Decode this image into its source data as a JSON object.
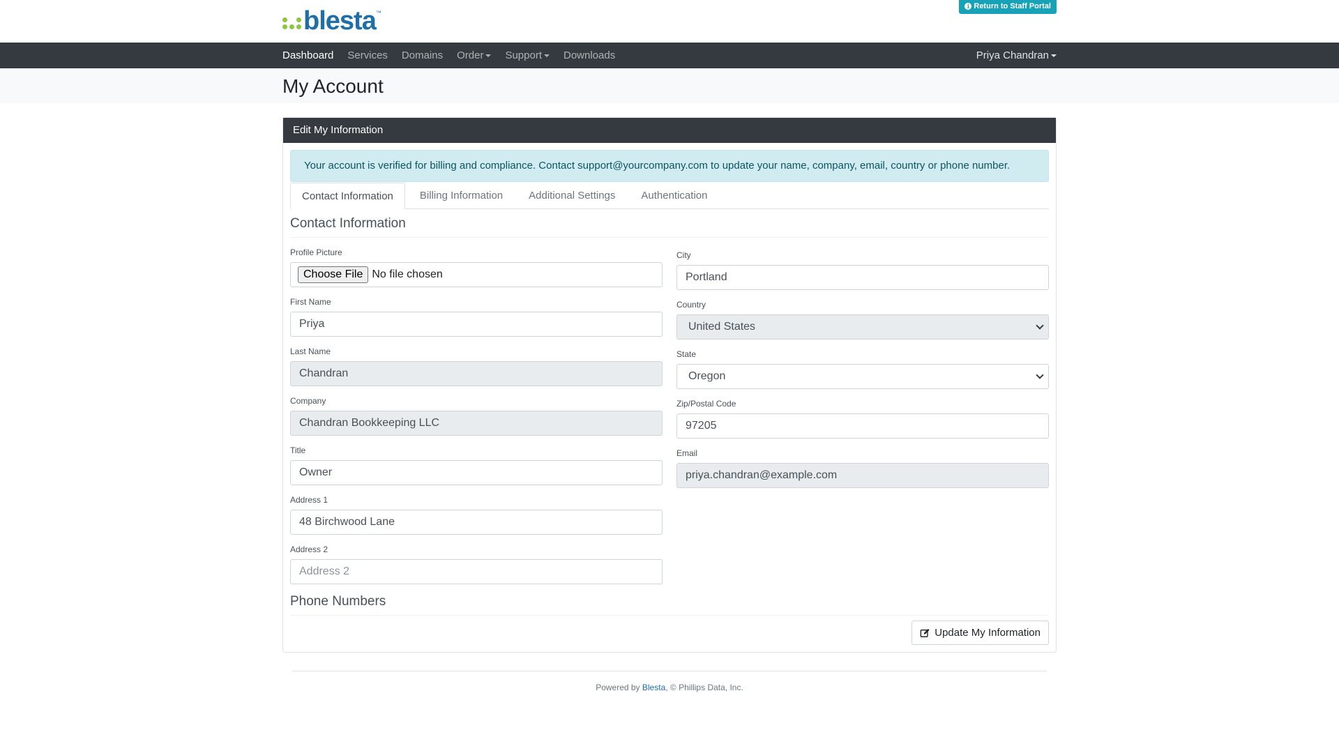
{
  "header": {
    "logo_text": "blesta",
    "logo_tm": "™",
    "logo_dot_colors": [
      "#8dc63f",
      "#1f6ea8"
    ],
    "staff_portal_label": "Return to Staff Portal"
  },
  "nav": {
    "items": [
      {
        "label": "Dashboard",
        "active": true,
        "dropdown": false
      },
      {
        "label": "Services",
        "active": false,
        "dropdown": false
      },
      {
        "label": "Domains",
        "active": false,
        "dropdown": false
      },
      {
        "label": "Order",
        "active": false,
        "dropdown": true
      },
      {
        "label": "Support",
        "active": false,
        "dropdown": true
      },
      {
        "label": "Downloads",
        "active": false,
        "dropdown": false
      }
    ],
    "user_label": "Priya Chandran"
  },
  "page": {
    "title": "My Account"
  },
  "card": {
    "header": "Edit My Information",
    "alert": "Your account is verified for billing and compliance. Contact support@yourcompany.com to update your name, company, email, country or phone number.",
    "tabs": [
      {
        "label": "Contact Information",
        "active": true
      },
      {
        "label": "Billing Information",
        "active": false
      },
      {
        "label": "Additional Settings",
        "active": false
      },
      {
        "label": "Authentication",
        "active": false
      }
    ],
    "section_title": "Contact Information",
    "left": {
      "profile_picture": {
        "label": "Profile Picture",
        "button": "Choose File",
        "status": "No file chosen"
      },
      "first_name": {
        "label": "First Name",
        "value": "Priya"
      },
      "last_name": {
        "label": "Last Name",
        "value": "Chandran"
      },
      "company": {
        "label": "Company",
        "value": "Chandran Bookkeeping LLC"
      },
      "title": {
        "label": "Title",
        "value": "Owner"
      },
      "address1": {
        "label": "Address 1",
        "value": "48 Birchwood Lane"
      },
      "address2": {
        "label": "Address 2",
        "placeholder": "Address 2"
      }
    },
    "right": {
      "city": {
        "label": "City",
        "value": "Portland"
      },
      "country": {
        "label": "Country",
        "value": "United States"
      },
      "state": {
        "label": "State",
        "value": "Oregon"
      },
      "zip": {
        "label": "Zip/Postal Code",
        "value": "97205"
      },
      "email": {
        "label": "Email",
        "value": "priya.chandran@example.com"
      }
    },
    "phone_title": "Phone Numbers",
    "update_button": "Update My Information"
  },
  "footer": {
    "prefix": "Powered by ",
    "link": "Blesta",
    "suffix": ", © Phillips Data, Inc."
  }
}
